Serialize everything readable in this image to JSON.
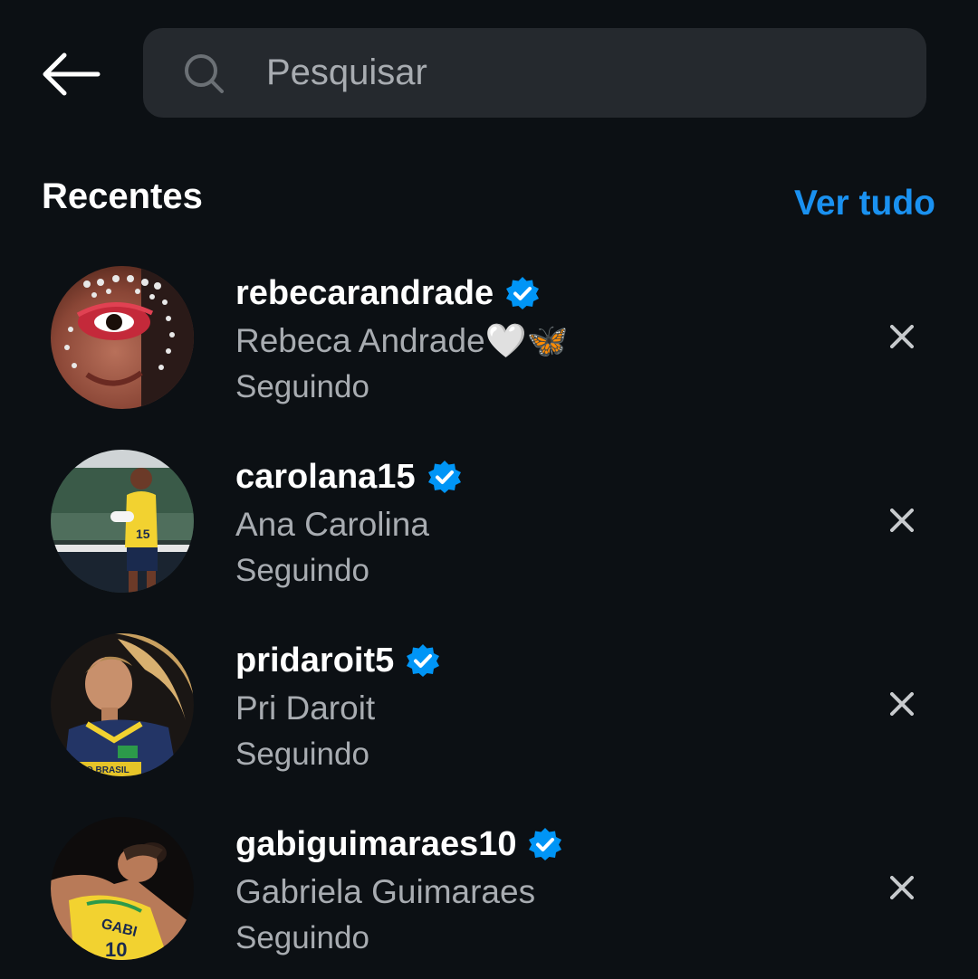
{
  "search": {
    "placeholder": "Pesquisar"
  },
  "recent": {
    "title": "Recentes",
    "see_all_label": "Ver tudo",
    "items": [
      {
        "username": "rebecarandrade",
        "full_name": "Rebeca Andrade🤍🦋",
        "status": "Seguindo",
        "verified": true
      },
      {
        "username": "carolana15",
        "full_name": "Ana Carolina",
        "status": "Seguindo",
        "verified": true
      },
      {
        "username": "pridaroit5",
        "full_name": "Pri Daroit",
        "status": "Seguindo",
        "verified": true
      },
      {
        "username": "gabiguimaraes10",
        "full_name": "Gabriela Guimaraes",
        "status": "Seguindo",
        "verified": true
      }
    ]
  },
  "icons": {
    "back": "back-arrow-icon",
    "search": "search-icon",
    "verified": "verified-badge-icon",
    "remove": "close-icon"
  },
  "colors": {
    "background": "#0c1014",
    "search_bg": "#25292e",
    "link": "#1a91f0",
    "verified": "#0095f6",
    "secondary_text": "#a8acb1"
  }
}
